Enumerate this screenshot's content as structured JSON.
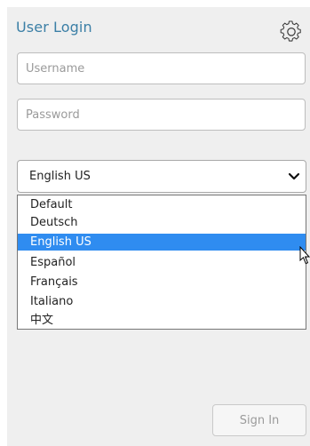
{
  "login": {
    "title": "User Login",
    "username_placeholder": "Username",
    "password_placeholder": "Password",
    "sign_in_label": "Sign In"
  },
  "language": {
    "selected": "English US",
    "options": [
      "Default",
      "Deutsch",
      "English US",
      "Español",
      "Français",
      "Italiano",
      "中文"
    ],
    "highlighted_index": 2
  },
  "icons": {
    "settings": "gear-icon",
    "select_arrow": "chevron-down-icon",
    "pointer": "mouse-pointer-icon"
  },
  "colors": {
    "title": "#3b7fa6",
    "highlight": "#2f8cf0",
    "panel_bg": "#efefef"
  }
}
